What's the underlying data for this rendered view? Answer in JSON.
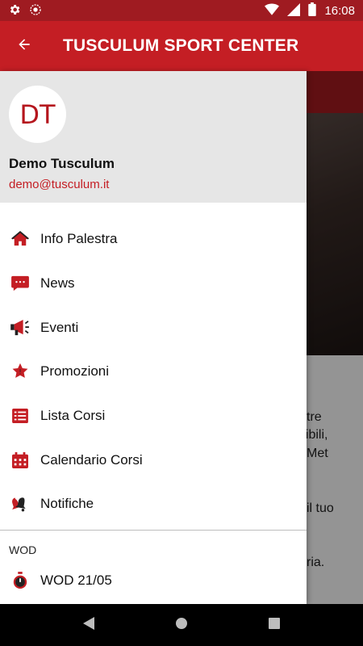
{
  "status_bar": {
    "time": "16:08",
    "left_icons": [
      "gear-icon",
      "sync-icon"
    ],
    "right_icons": [
      "wifi-icon",
      "signal-icon",
      "battery-icon"
    ]
  },
  "app_bar": {
    "title": "TUSCULUM SPORT CENTER",
    "back_icon": "arrow-back-icon"
  },
  "drawer": {
    "avatar_initials": "DT",
    "user_name": "Demo Tusculum",
    "user_email": "demo@tusculum.it",
    "menu_items": [
      {
        "label": "Info Palestra",
        "icon": "home-icon"
      },
      {
        "label": "News",
        "icon": "chat-icon"
      },
      {
        "label": "Eventi",
        "icon": "megaphone-icon"
      },
      {
        "label": "Promozioni",
        "icon": "star-badge-icon"
      },
      {
        "label": "Lista Corsi",
        "icon": "list-icon"
      },
      {
        "label": "Calendario Corsi",
        "icon": "calendar-icon"
      },
      {
        "label": "Notifiche",
        "icon": "bells-icon"
      }
    ],
    "section_header": "WOD",
    "wod_item": {
      "label": "WOD 21/05",
      "icon": "stopwatch-icon"
    }
  },
  "background": {
    "text_lines": [
      "tre",
      "nibili,",
      "Met",
      "il tuo",
      "ria."
    ]
  },
  "colors": {
    "primary": "#c41e24",
    "status_bar": "#9f1b21",
    "drawer_header": "#e6e6e6"
  }
}
